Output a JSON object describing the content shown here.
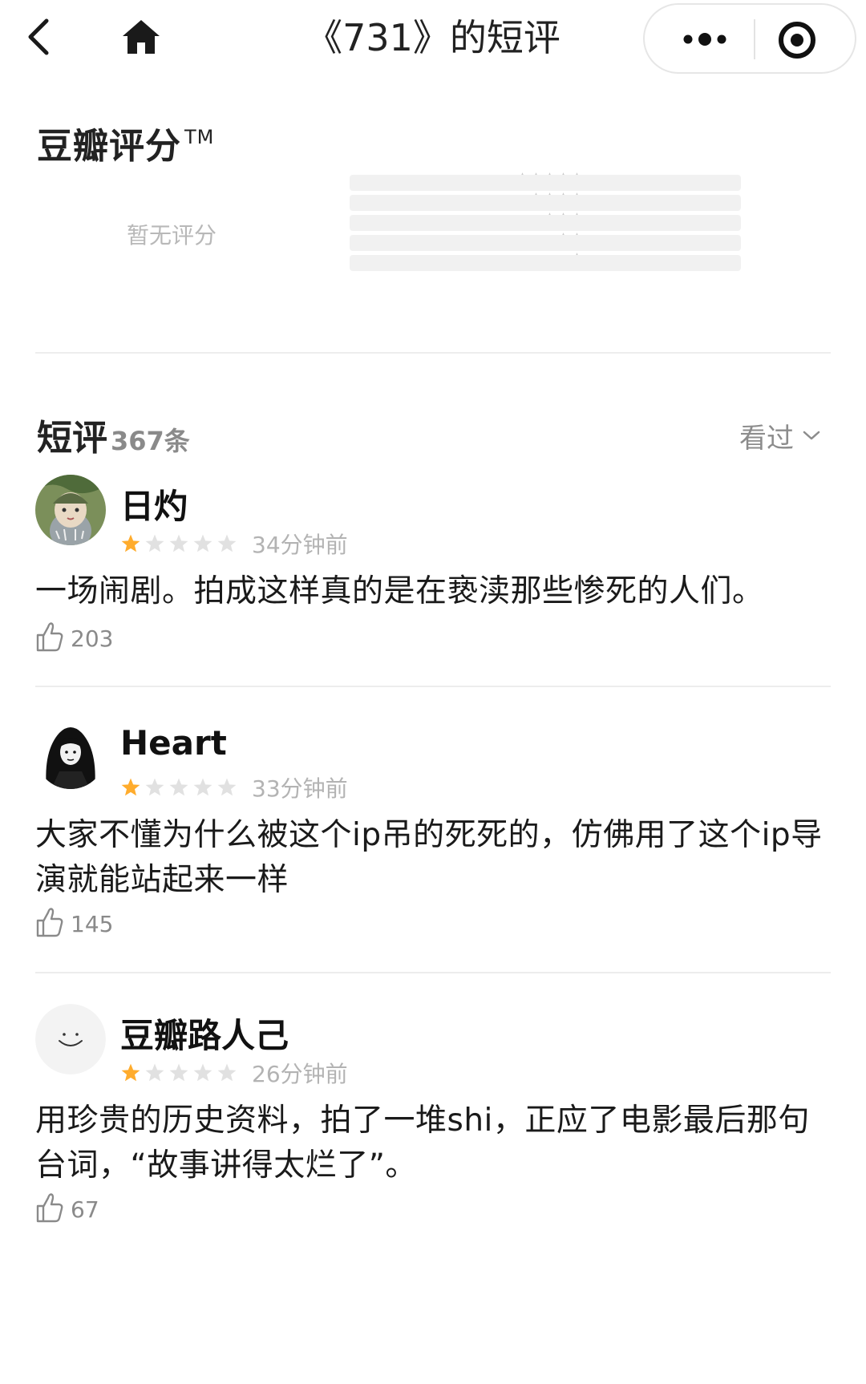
{
  "nav": {
    "title": "《731》的短评"
  },
  "rating": {
    "title": "豆瓣评分",
    "trademark": "TM",
    "no_rating_text": "暂无评分",
    "distribution": [
      {
        "stars": 5,
        "fraction": 0
      },
      {
        "stars": 4,
        "fraction": 0
      },
      {
        "stars": 3,
        "fraction": 0
      },
      {
        "stars": 2,
        "fraction": 0
      },
      {
        "stars": 1,
        "fraction": 0
      }
    ]
  },
  "reviews_header": {
    "title": "短评",
    "count": "367条",
    "filter_label": "看过"
  },
  "reviews": [
    {
      "user": "日灼",
      "rating": 1,
      "time": "34分钟前",
      "content": "一场闹剧。拍成这样真的是在亵渎那些惨死的人们。",
      "likes": "203"
    },
    {
      "user": "Heart",
      "rating": 1,
      "time": "33分钟前",
      "content": "大家不懂为什么被这个ip吊的死死的，仿佛用了这个ip导演就能站起来一样",
      "likes": "145"
    },
    {
      "user": "豆瓣路人己",
      "rating": 1,
      "time": "26分钟前",
      "content": "用珍贵的历史资料，拍了一堆shi，正应了电影最后那句台词，“故事讲得太烂了”。",
      "likes": "67"
    }
  ],
  "colors": {
    "star_active": "#ffac2d",
    "star_inactive": "#e1e1e1",
    "divider": "#ededed",
    "muted_text": "#8c8c8c"
  }
}
